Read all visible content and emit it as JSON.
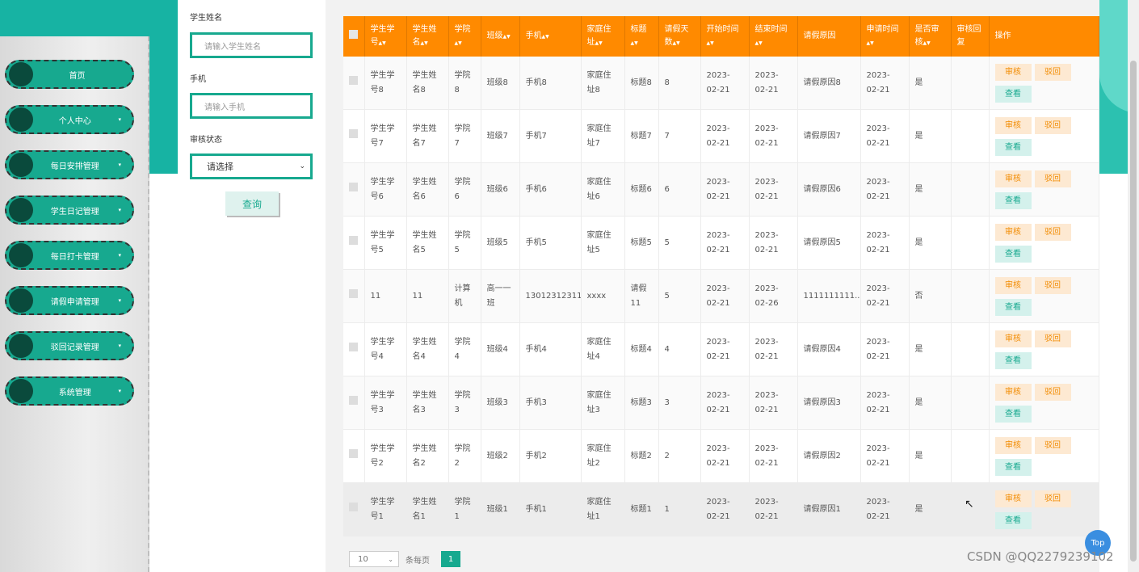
{
  "sidebar": {
    "items": [
      {
        "label": "首页",
        "dropdown": false
      },
      {
        "label": "个人中心",
        "dropdown": true
      },
      {
        "label": "每日安排管理",
        "dropdown": true
      },
      {
        "label": "学生日记管理",
        "dropdown": true
      },
      {
        "label": "每日打卡管理",
        "dropdown": true
      },
      {
        "label": "请假申请管理",
        "dropdown": true
      },
      {
        "label": "驳回记录管理",
        "dropdown": true
      },
      {
        "label": "系统管理",
        "dropdown": true
      }
    ]
  },
  "search": {
    "name_label": "学生姓名",
    "name_placeholder": "请输入学生姓名",
    "phone_label": "手机",
    "phone_placeholder": "请输入手机",
    "status_label": "审核状态",
    "status_value": "请选择",
    "query_label": "查询"
  },
  "table": {
    "headers": [
      {
        "label": "学生学号",
        "sortable": true
      },
      {
        "label": "学生姓名",
        "sortable": true
      },
      {
        "label": "学院",
        "sortable": true
      },
      {
        "label": "班级",
        "sortable": true
      },
      {
        "label": "手机",
        "sortable": true
      },
      {
        "label": "家庭住址",
        "sortable": true
      },
      {
        "label": "标题",
        "sortable": true
      },
      {
        "label": "请假天数",
        "sortable": true
      },
      {
        "label": "开始时间",
        "sortable": true
      },
      {
        "label": "结束时间",
        "sortable": true
      },
      {
        "label": "请假原因",
        "sortable": false
      },
      {
        "label": "申请时间",
        "sortable": true
      },
      {
        "label": "是否审核",
        "sortable": true
      },
      {
        "label": "审核回复",
        "sortable": false
      },
      {
        "label": "操作",
        "sortable": false
      }
    ],
    "rows": [
      [
        "学生学号8",
        "学生姓名8",
        "学院8",
        "班级8",
        "手机8",
        "家庭住址8",
        "标题8",
        "8",
        "2023-02-21",
        "2023-02-21",
        "请假原因8",
        "2023-02-21",
        "是",
        ""
      ],
      [
        "学生学号7",
        "学生姓名7",
        "学院7",
        "班级7",
        "手机7",
        "家庭住址7",
        "标题7",
        "7",
        "2023-02-21",
        "2023-02-21",
        "请假原因7",
        "2023-02-21",
        "是",
        ""
      ],
      [
        "学生学号6",
        "学生姓名6",
        "学院6",
        "班级6",
        "手机6",
        "家庭住址6",
        "标题6",
        "6",
        "2023-02-21",
        "2023-02-21",
        "请假原因6",
        "2023-02-21",
        "是",
        ""
      ],
      [
        "学生学号5",
        "学生姓名5",
        "学院5",
        "班级5",
        "手机5",
        "家庭住址5",
        "标题5",
        "5",
        "2023-02-21",
        "2023-02-21",
        "请假原因5",
        "2023-02-21",
        "是",
        ""
      ],
      [
        "11",
        "11",
        "计算机",
        "高一一班",
        "13012312311",
        "xxxx",
        "请假11",
        "5",
        "2023-02-21",
        "2023-02-26",
        "1111111111...",
        "2023-02-21",
        "否",
        ""
      ],
      [
        "学生学号4",
        "学生姓名4",
        "学院4",
        "班级4",
        "手机4",
        "家庭住址4",
        "标题4",
        "4",
        "2023-02-21",
        "2023-02-21",
        "请假原因4",
        "2023-02-21",
        "是",
        ""
      ],
      [
        "学生学号3",
        "学生姓名3",
        "学院3",
        "班级3",
        "手机3",
        "家庭住址3",
        "标题3",
        "3",
        "2023-02-21",
        "2023-02-21",
        "请假原因3",
        "2023-02-21",
        "是",
        ""
      ],
      [
        "学生学号2",
        "学生姓名2",
        "学院2",
        "班级2",
        "手机2",
        "家庭住址2",
        "标题2",
        "2",
        "2023-02-21",
        "2023-02-21",
        "请假原因2",
        "2023-02-21",
        "是",
        ""
      ],
      [
        "学生学号1",
        "学生姓名1",
        "学院1",
        "班级1",
        "手机1",
        "家庭住址1",
        "标题1",
        "1",
        "2023-02-21",
        "2023-02-21",
        "请假原因1",
        "2023-02-21",
        "是",
        ""
      ]
    ],
    "actions": {
      "audit": "审核",
      "reject": "驳回",
      "view": "查看"
    }
  },
  "pager": {
    "page_size": "10",
    "per_page_label": "条每页",
    "current_page": "1"
  },
  "top_button": "Top",
  "watermark": "CSDN @QQ2279239102",
  "colors": {
    "header": "#ff8a00",
    "accent": "#17a98f",
    "menu_bg": "#17a98f"
  }
}
